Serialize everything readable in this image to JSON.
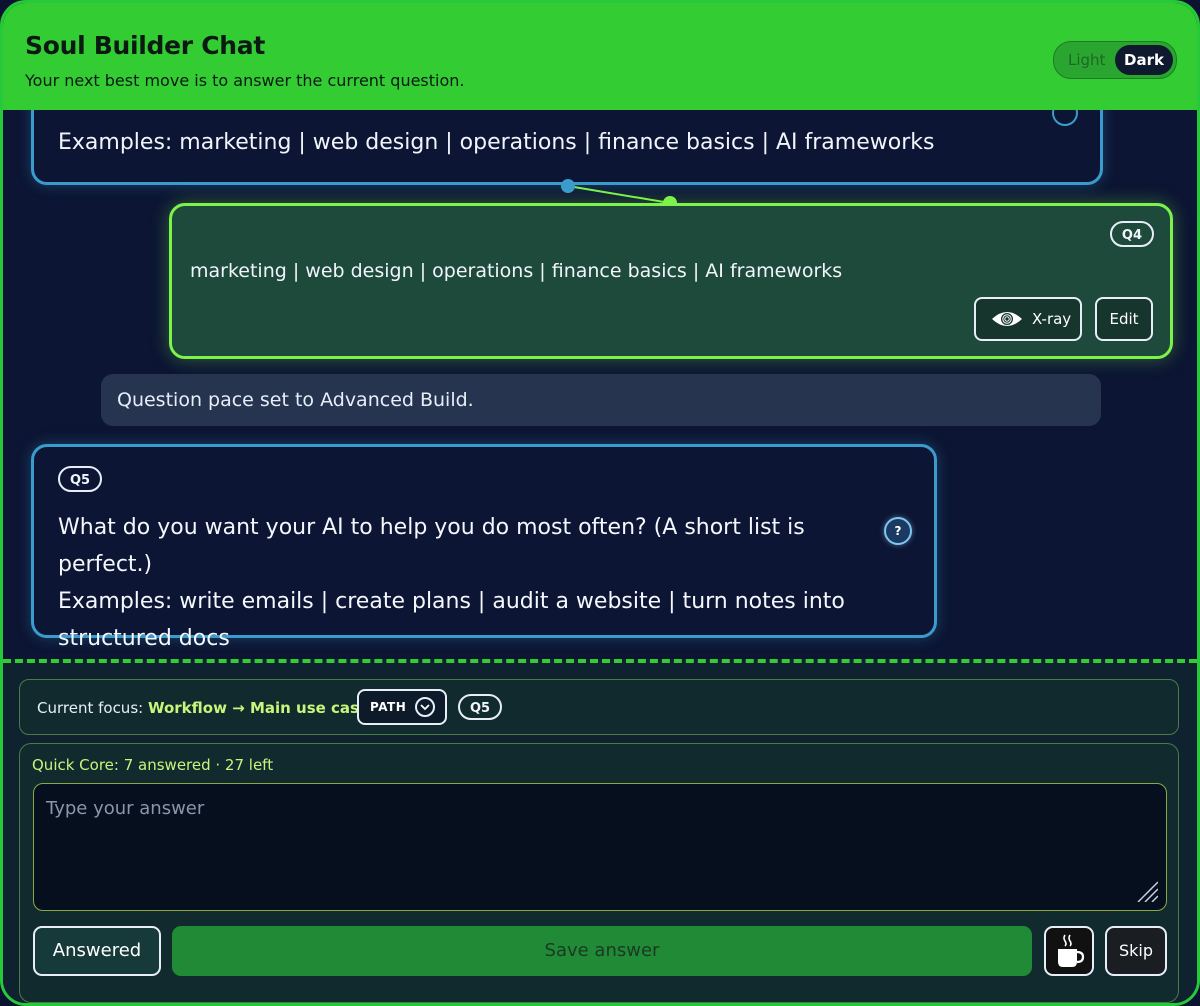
{
  "header": {
    "title": "Soul Builder Chat",
    "subtitle": "Your next best move is to answer the current question.",
    "theme": {
      "light_label": "Light",
      "dark_label": "Dark",
      "selected": "Dark"
    }
  },
  "chat": {
    "previous_question": {
      "examples": "Examples: marketing | web design | operations | finance basics | AI frameworks"
    },
    "answer": {
      "badge": "Q4",
      "text": "marketing | web design | operations | finance basics | AI frameworks",
      "xray_label": "X-ray",
      "edit_label": "Edit"
    },
    "system_message": "Question pace set to Advanced Build.",
    "current_question": {
      "badge": "Q5",
      "text": "What do you want your AI to help you do most often? (A short list is perfect.)",
      "examples": "Examples: write emails | create plans | audit a website | turn notes into structured docs",
      "help_label": "?"
    }
  },
  "focus": {
    "prefix": "Current focus: ",
    "value": "Workflow → Main use cases",
    "path_label": "PATH",
    "badge": "Q5"
  },
  "answer_panel": {
    "progress": "Quick Core: 7 answered · 27 left",
    "placeholder": "Type your answer",
    "answered_label": "Answered",
    "save_label": "Save answer",
    "skip_label": "Skip",
    "break_icon": "coffee-cup-icon"
  },
  "colors": {
    "header_green": "#33cc33",
    "question_border": "#3a9ccc",
    "answer_border": "#7cf24a",
    "save_button": "#218a36"
  }
}
